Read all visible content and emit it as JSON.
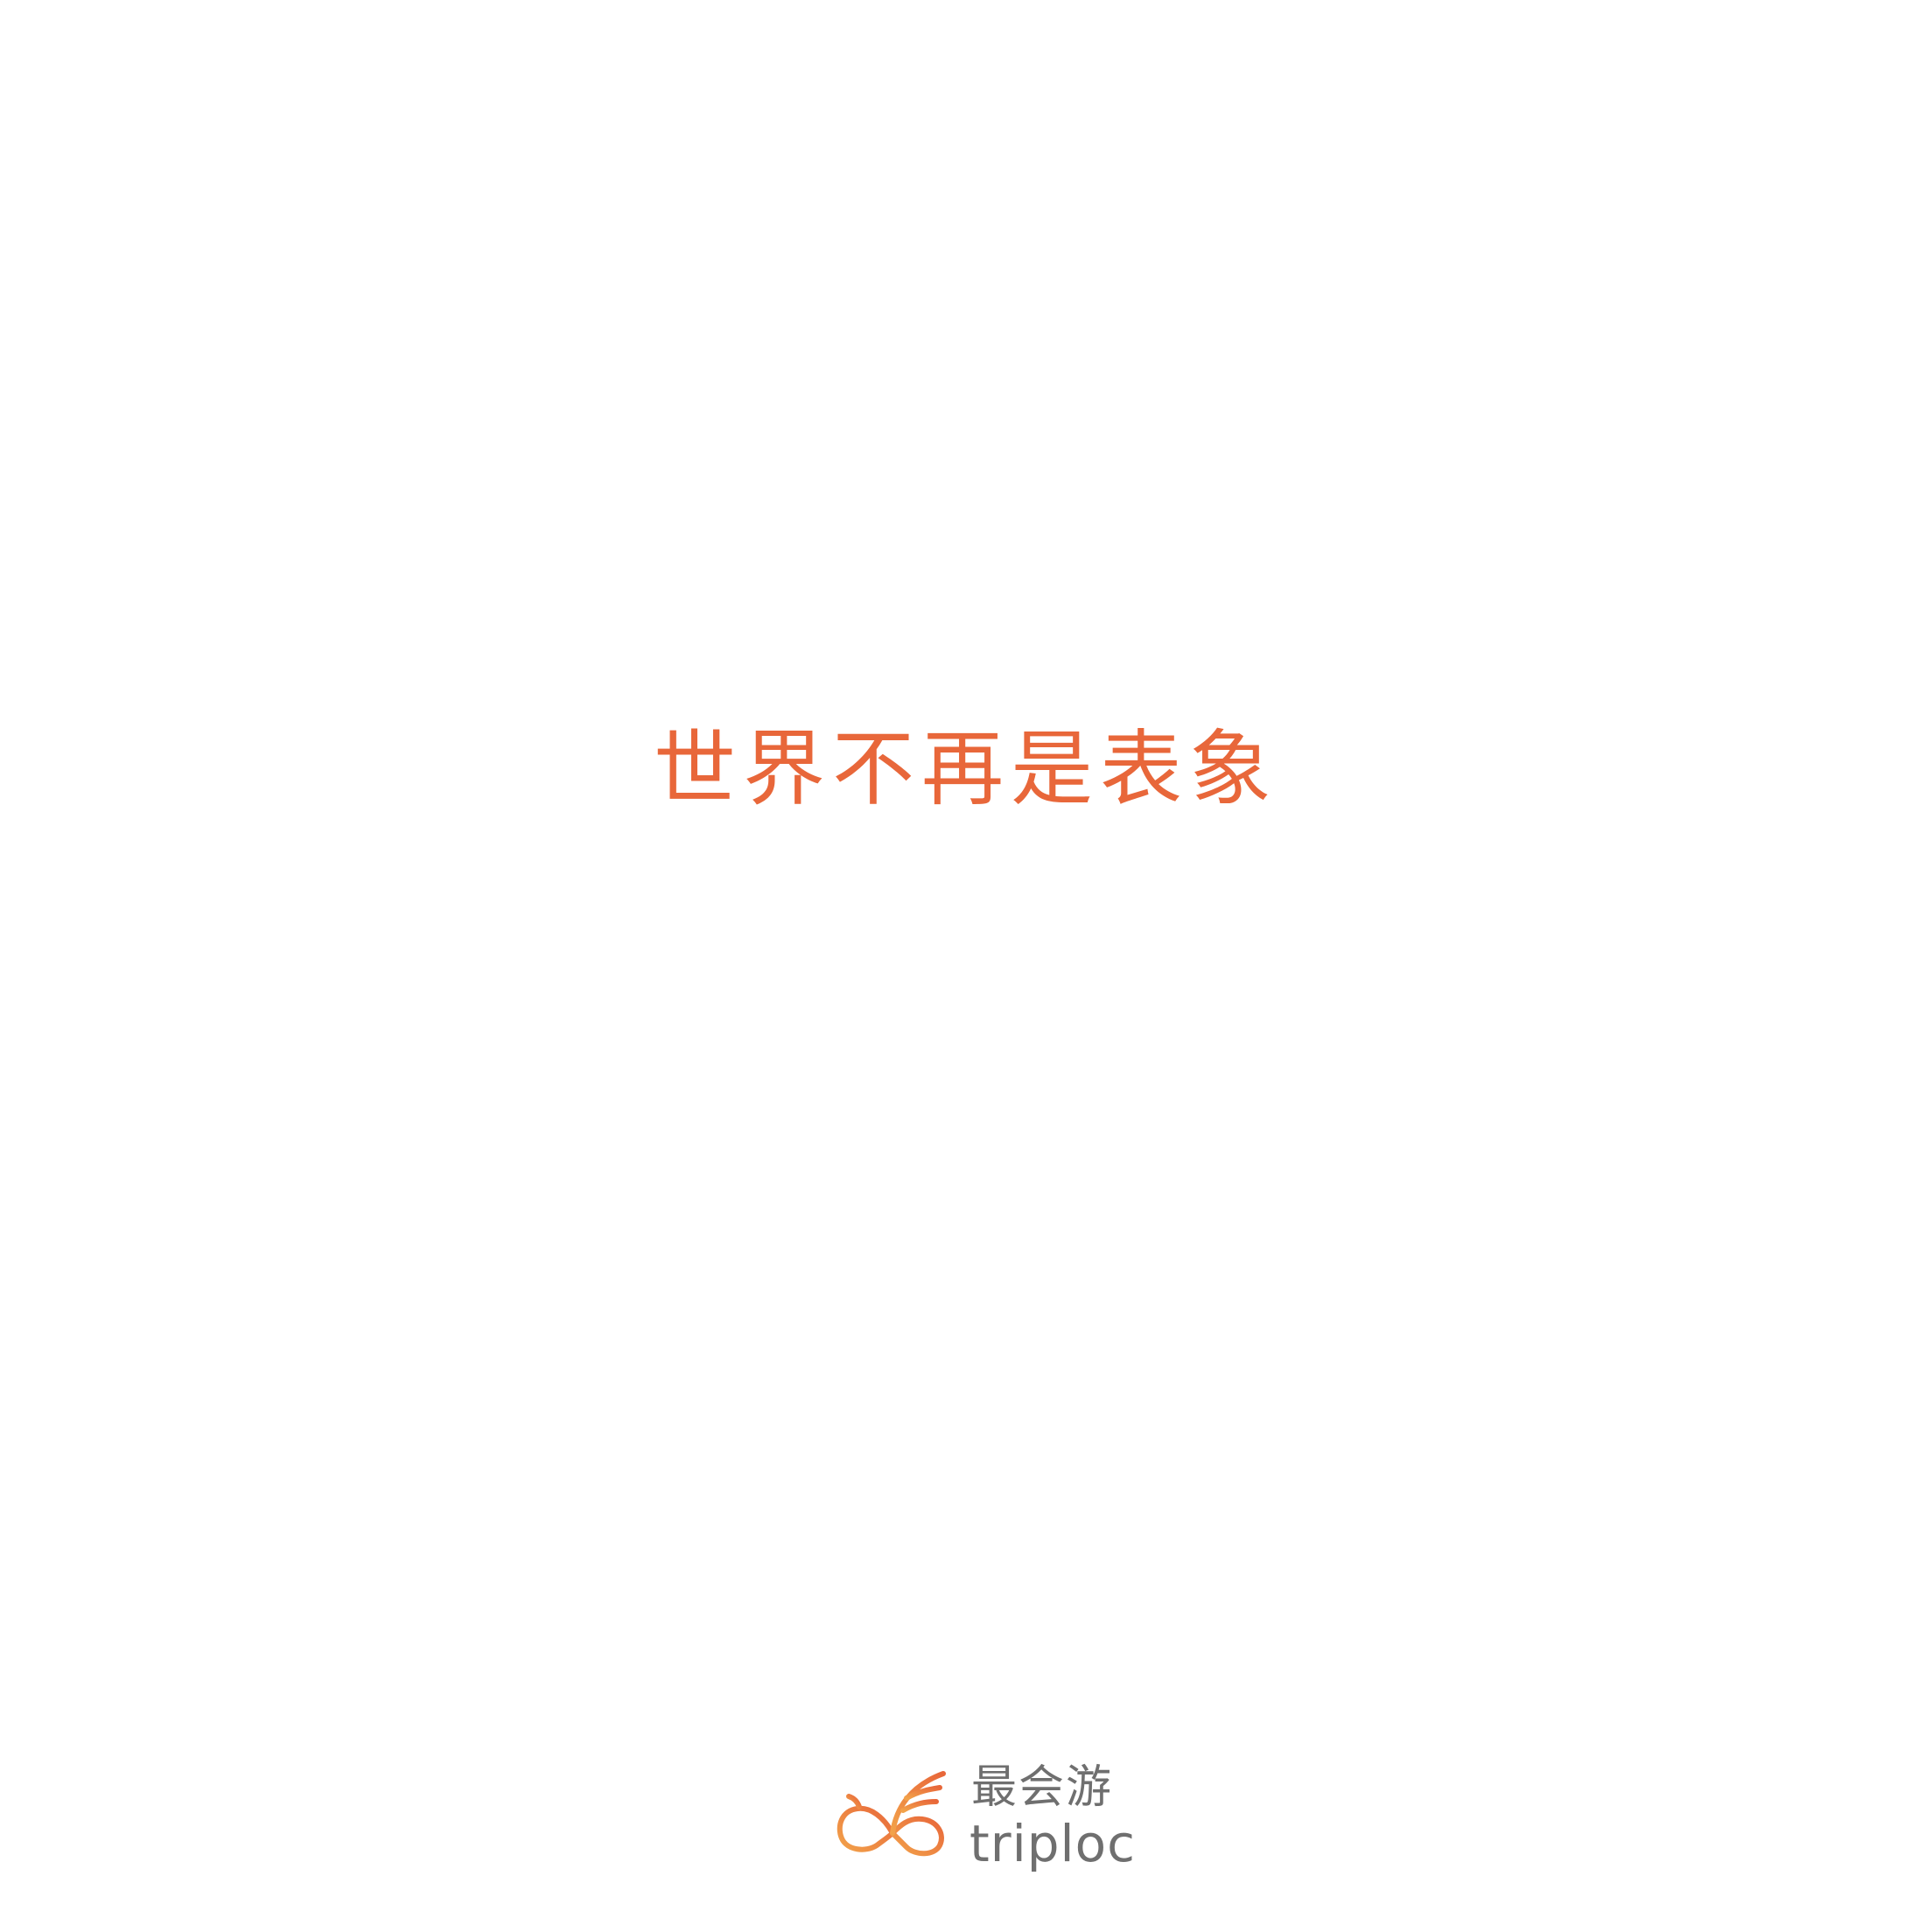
{
  "tagline": "世界不再是表象",
  "brand": {
    "name_cn": "最会游",
    "name_en": "triploc",
    "logo_icon": "winged-infinity-icon"
  },
  "colors": {
    "accent": "#e8673a",
    "accent_light": "#f2a24a",
    "brand_text": "#6f6f6f",
    "background": "#ffffff"
  }
}
